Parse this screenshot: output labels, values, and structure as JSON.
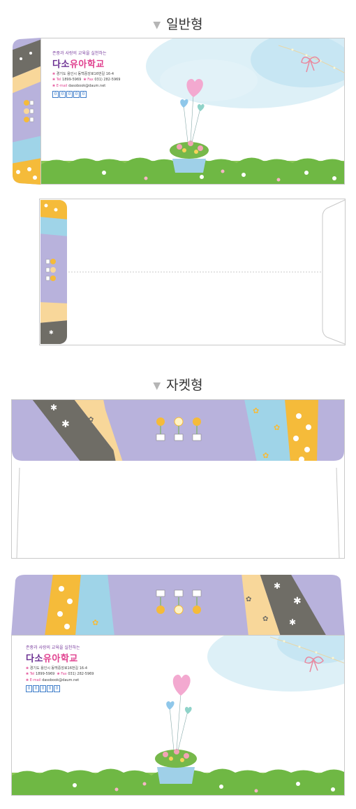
{
  "sections": {
    "general": {
      "title": "일반형"
    },
    "jacket": {
      "title": "자켓형"
    }
  },
  "envelope": {
    "tagline": "존중과 사랑의 교육을 실천하는",
    "school_name_part1": "다소",
    "school_name_part2": "유아학교",
    "address": "경기도 용인시 동백중앙로16번길 16-4",
    "tel_label": "Tel",
    "tel": "1899-5969",
    "fax_label": "Fax",
    "fax": "031) 282-5969",
    "email_label": "E-mail",
    "email": "dasobook@daum.net",
    "zip_boxes": [
      "0",
      "0",
      "0",
      "0",
      "0"
    ]
  },
  "colors": {
    "lavender": "#b8b2dc",
    "gray_stripe": "#6f6d66",
    "peach": "#f8d79a",
    "sky": "#9fd4e8",
    "yellow": "#f5bb3a",
    "grass": "#7cc04b",
    "brand_purple": "#6a2e91",
    "brand_pink": "#e0418f"
  }
}
